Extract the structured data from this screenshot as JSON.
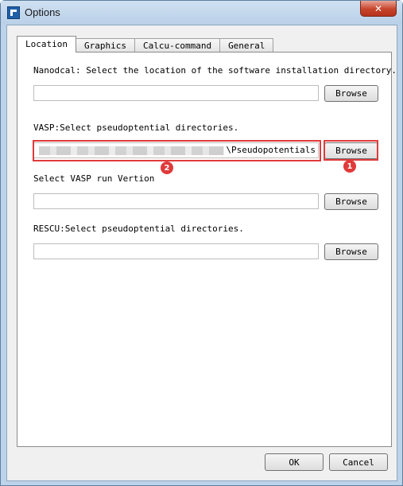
{
  "window": {
    "title": "Options",
    "close_glyph": "✕"
  },
  "tabs": [
    {
      "label": "Location",
      "active": true
    },
    {
      "label": "Graphics",
      "active": false
    },
    {
      "label": "Calcu-command",
      "active": false
    },
    {
      "label": "General",
      "active": false
    }
  ],
  "location": {
    "nanodcal": {
      "label": "Nanodcal: Select the location of the software installation directory.",
      "value": "",
      "button": "Browse"
    },
    "vasp": {
      "label": "VASP:Select pseudoptential directories.",
      "value_suffix": "\\Pseudopotentials",
      "button": "Browse"
    },
    "vasp_run": {
      "label": "Select VASP run Vertion",
      "value": "",
      "button": "Browse"
    },
    "rescu": {
      "label": "RESCU:Select pseudoptential directories.",
      "value": "",
      "button": "Browse"
    }
  },
  "annotations": {
    "marker_1": "1",
    "marker_2": "2",
    "color": "#e03a3a"
  },
  "footer": {
    "ok": "OK",
    "cancel": "Cancel"
  },
  "icons": {
    "app": "app-logo-icon",
    "close": "close-icon"
  }
}
